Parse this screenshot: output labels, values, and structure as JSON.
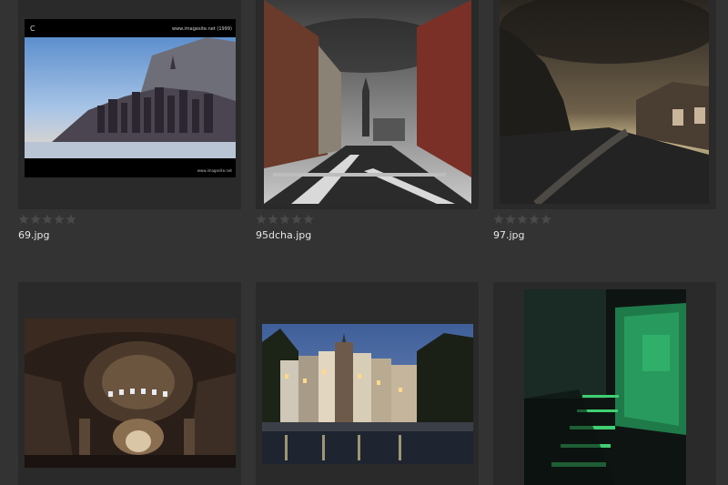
{
  "gallery": {
    "items": [
      {
        "filename": "69.jpg",
        "rating": 0,
        "max_rating": 5,
        "image_top_left_text": "C",
        "image_top_right_text": "www.imagesite.net (1999)",
        "image_bottom_right_text": "www.imagesite.net"
      },
      {
        "filename": "95dcha.jpg",
        "rating": 0,
        "max_rating": 5
      },
      {
        "filename": "97.jpg",
        "rating": 0,
        "max_rating": 5
      },
      {
        "filename": "",
        "rating": 0,
        "max_rating": 5
      },
      {
        "filename": "",
        "rating": 0,
        "max_rating": 5
      },
      {
        "filename": "",
        "rating": 0,
        "max_rating": 5
      }
    ]
  },
  "colors": {
    "page_background": "#333333",
    "frame_background": "#2a2a2a",
    "filename_text": "#e6e6e6",
    "star_empty": "#4a4a4a"
  },
  "icons": {
    "rating": "star-icon"
  }
}
